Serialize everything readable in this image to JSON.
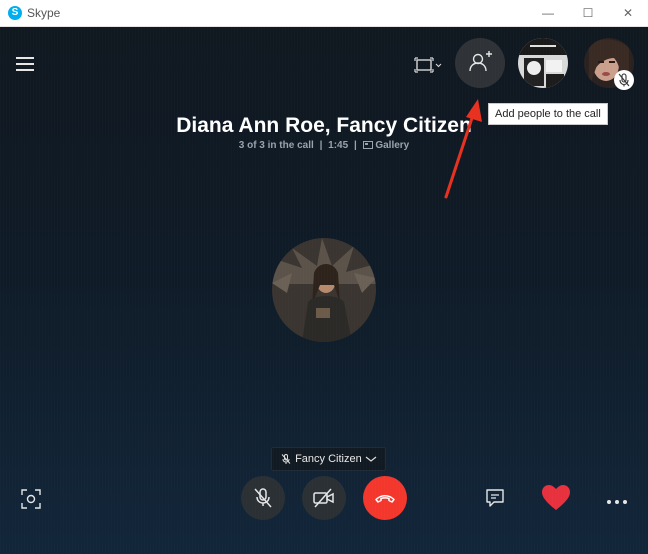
{
  "window": {
    "app_title": "Skype",
    "logo_letter": "S",
    "controls": {
      "minimize": "—",
      "maximize": "☐",
      "close": "✕"
    }
  },
  "call": {
    "title": "Diana Ann Roe, Fancy Citizen",
    "participants": "3 of 3 in the call",
    "duration": "1:45",
    "view_label": "Gallery"
  },
  "tooltip": {
    "add_people": "Add people to the call"
  },
  "speaker": {
    "name": "Fancy Citizen"
  },
  "colors": {
    "end_call": "#f4372c",
    "heart": "#e8313f",
    "annotation_arrow": "#e8311f",
    "control_bg": "#2b3035"
  },
  "icons": {
    "menu": "hamburger-icon",
    "layout": "layout-frame-icon",
    "add_person": "add-person-icon",
    "mic_muted": "mic-muted-icon",
    "video_off": "video-off-icon",
    "hang_up": "phone-hangup-icon",
    "chat": "chat-icon",
    "react": "heart-icon",
    "more": "more-options-icon",
    "snapshot": "screenshot-icon"
  }
}
